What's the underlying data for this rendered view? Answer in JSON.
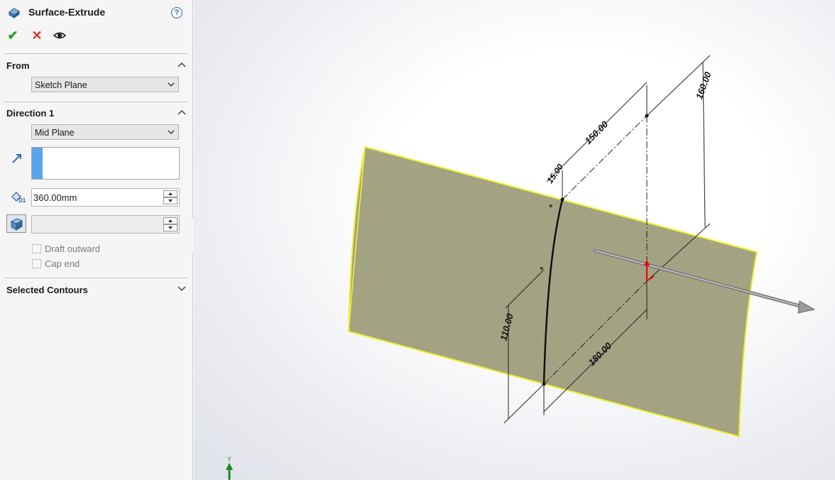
{
  "feature": {
    "title": "Surface-Extrude",
    "help": "?"
  },
  "actions": {
    "ok": "✔",
    "cancel": "✕"
  },
  "from": {
    "header": "From",
    "selected": "Sketch Plane"
  },
  "direction1": {
    "header": "Direction 1",
    "end_condition": "Mid Plane",
    "depth": "360.00mm",
    "draft_outward_label": "Draft outward",
    "cap_end_label": "Cap end",
    "draft_outward_checked": false,
    "cap_end_checked": false
  },
  "selected_contours": {
    "header": "Selected Contours"
  },
  "viewport": {
    "dimensions": {
      "d150": "150.00",
      "d160": "160.00",
      "d15": "15.00",
      "d110": "110.00",
      "d180": "180.00"
    },
    "triad_axis": "Y"
  },
  "colors": {
    "surface": "#a3a384",
    "surface_edge": "#f2f230",
    "accent_blue": "#5aa4ec"
  }
}
